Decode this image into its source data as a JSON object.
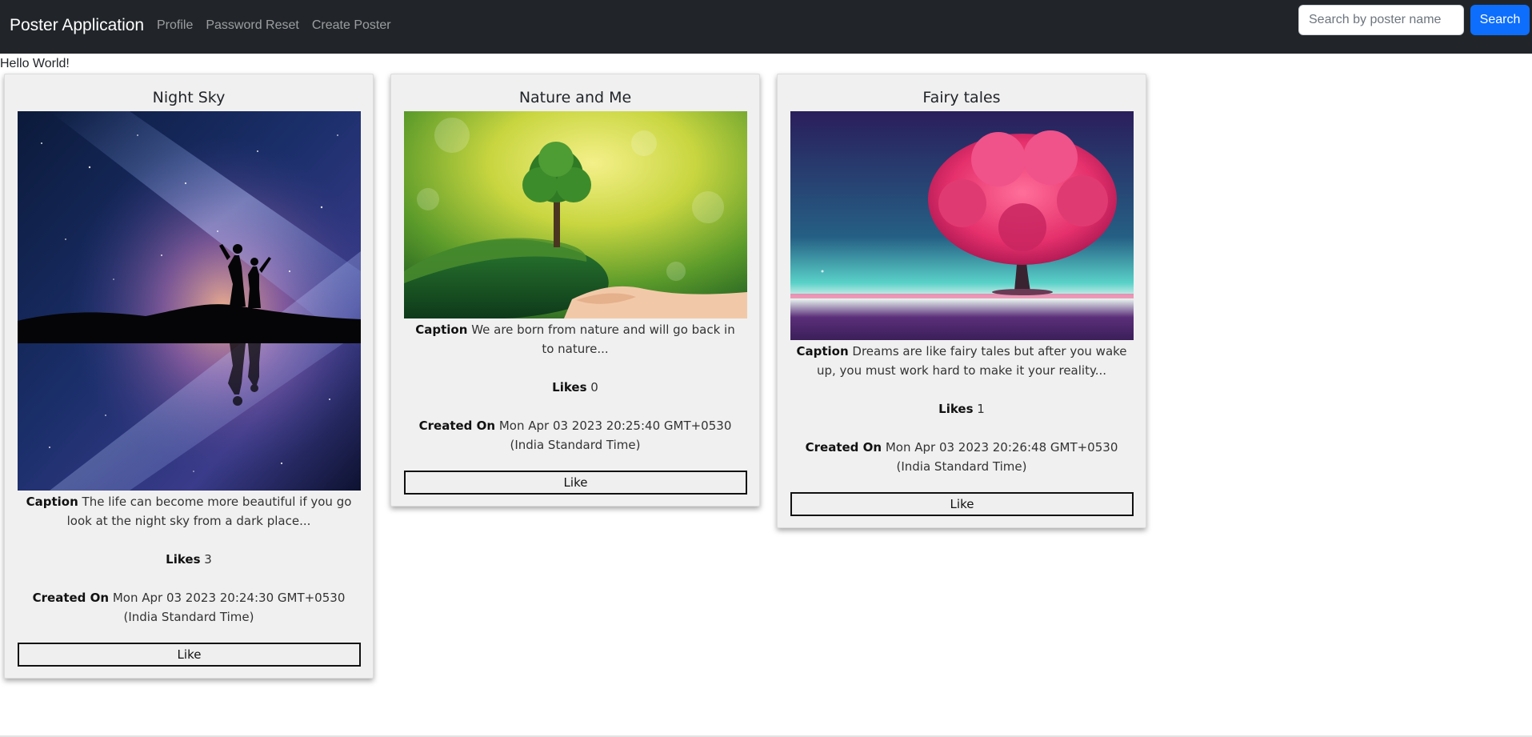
{
  "navbar": {
    "brand": "Poster Application",
    "links": [
      "Profile",
      "Password Reset",
      "Create Poster"
    ],
    "search_placeholder": "Search by poster name",
    "search_button": "Search"
  },
  "greeting": "Hello World!",
  "labels": {
    "caption": "Caption",
    "likes": "Likes",
    "created_on": "Created On",
    "like_button": "Like"
  },
  "posters": [
    {
      "title": "Night Sky",
      "caption": "The life can become more beautiful if you go look at the night sky from a dark place...",
      "likes": "3",
      "created_on": "Mon Apr 03 2023 20:24:30 GMT+0530 (India Standard Time)",
      "image": "night-sky-milky-way-silhouette"
    },
    {
      "title": "Nature and Me",
      "caption": "We are born from nature and will go back in to nature...",
      "likes": "0",
      "created_on": "Mon Apr 03 2023 20:25:40 GMT+0530 (India Standard Time)",
      "image": "tree-in-hand"
    },
    {
      "title": "Fairy tales",
      "caption": "Dreams are like fairy tales but after you wake up, you must work hard to make it your reality...",
      "likes": "1",
      "created_on": "Mon Apr 03 2023 20:26:48 GMT+0530 (India Standard Time)",
      "image": "pink-tree-fantasy"
    }
  ],
  "colors": {
    "navbar_bg": "#212529",
    "primary": "#0d6efd",
    "card_bg": "#f0f0f0"
  }
}
